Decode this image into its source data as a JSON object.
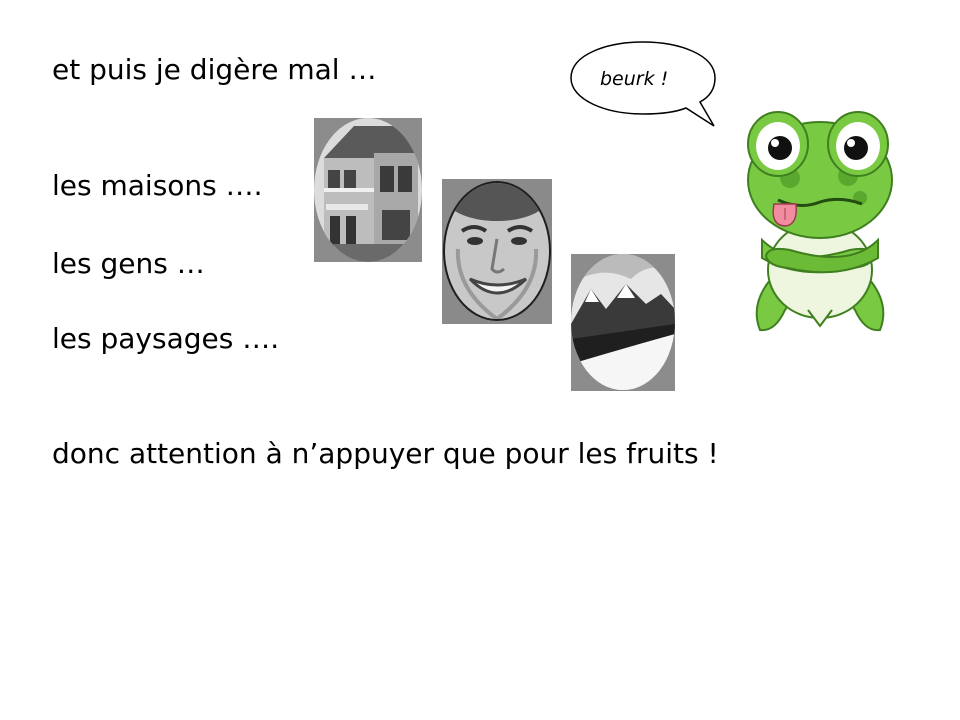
{
  "slide": {
    "lines": [
      "et puis je digère mal  …",
      "les maisons ….",
      "les gens …",
      "les paysages ….",
      "donc attention à n’appuyer que pour les fruits !"
    ],
    "speech_bubble": "beurk !"
  },
  "images": [
    {
      "name": "house-photo",
      "style": "grayscale",
      "shape": "oval"
    },
    {
      "name": "face-photo",
      "style": "grayscale",
      "shape": "oval"
    },
    {
      "name": "landscape-photo",
      "style": "grayscale",
      "shape": "oval"
    },
    {
      "name": "turtle-cartoon",
      "color": "#7ac943"
    }
  ]
}
